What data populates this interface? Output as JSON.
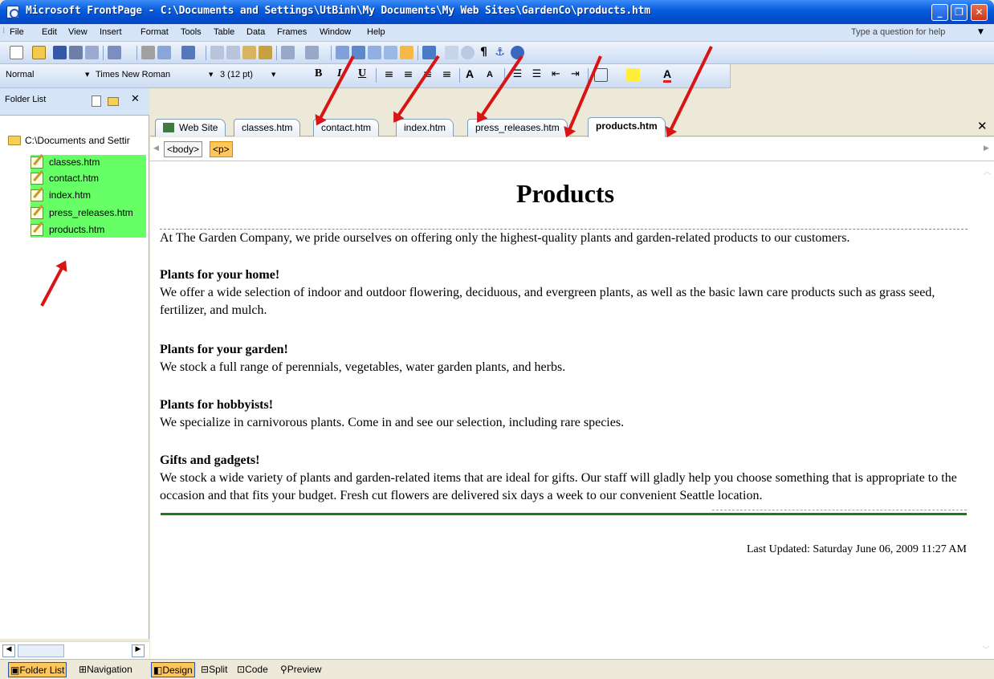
{
  "window": {
    "title": "Microsoft FrontPage - C:\\Documents and Settings\\UtBinh\\My Documents\\My Web Sites\\GardenCo\\products.htm"
  },
  "menu": {
    "items": [
      "File",
      "Edit",
      "View",
      "Insert",
      "Format",
      "Tools",
      "Table",
      "Data",
      "Frames",
      "Window",
      "Help"
    ],
    "help_placeholder": "Type a question for help"
  },
  "formatting": {
    "style": "Normal",
    "font": "Times New Roman",
    "size": "3 (12 pt)"
  },
  "folder_list": {
    "title": "Folder List",
    "root": "C:\\Documents and Settir",
    "files": [
      "classes.htm",
      "contact.htm",
      "index.htm",
      "press_releases.htm",
      "products.htm"
    ]
  },
  "tabs": [
    "Web Site",
    "classes.htm",
    "contact.htm",
    "index.htm",
    "press_releases.htm",
    "products.htm"
  ],
  "tags": [
    "<body>",
    "<p>"
  ],
  "page": {
    "heading": "Products",
    "intro": "At The Garden Company, we pride ourselves on offering only the highest-quality plants and garden-related products to our customers.",
    "sections": [
      {
        "heading": "Plants for your home!",
        "text": "We offer a wide selection of indoor and outdoor flowering, deciduous, and evergreen plants, as well as the basic lawn care products such as grass seed, fertilizer, and mulch."
      },
      {
        "heading": "Plants for your garden!",
        "text": "We stock a full range of perennials, vegetables, water garden plants, and herbs."
      },
      {
        "heading": "Plants for hobbyists!",
        "text": "We specialize in carnivorous plants. Come in and see our selection, including rare species."
      },
      {
        "heading": "Gifts and gadgets!",
        "text": "We stock a wide variety of plants and garden-related items that are ideal for gifts. Our staff will gladly help you choose something that is appropriate to the occasion and that fits your budget. Fresh cut flowers are delivered six days a week to our convenient Seattle location."
      }
    ],
    "updated": "Last Updated: Saturday June 06, 2009 11:27 AM"
  },
  "bottom": {
    "folder_list": "Folder List",
    "navigation": "Navigation",
    "views": [
      "Design",
      "Split",
      "Code",
      "Preview"
    ]
  },
  "colors": {
    "highlight": "#66ff66",
    "arrow": "#d91414",
    "selected_view": "#ffc65c"
  }
}
